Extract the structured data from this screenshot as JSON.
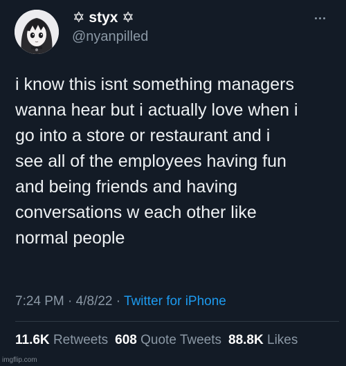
{
  "author": {
    "display_name": "✡ styx ✡",
    "handle": "@nyanpilled"
  },
  "icons": {
    "avatar": "avatar-anime-girl",
    "menu": "more-horizontal-icon"
  },
  "tweet": {
    "lines": [
      "i know this isnt something managers",
      "wanna hear but i actually love when i",
      "go into a store or restaurant and i",
      "see all of the employees having fun",
      "and being friends and having",
      "conversations w each other like",
      "normal people"
    ],
    "time": "7:24 PM",
    "date": "4/8/22",
    "separator": "·",
    "source": "Twitter for iPhone"
  },
  "stats": {
    "retweets_count": "11.6K",
    "retweets_label": "Retweets",
    "quotes_count": "608",
    "quotes_label": "Quote Tweets",
    "likes_count": "88.8K",
    "likes_label": "Likes"
  },
  "watermark": "imgflip.com",
  "colors": {
    "background": "#131b26",
    "link": "#1d9bf0",
    "muted": "#8b98a5"
  }
}
